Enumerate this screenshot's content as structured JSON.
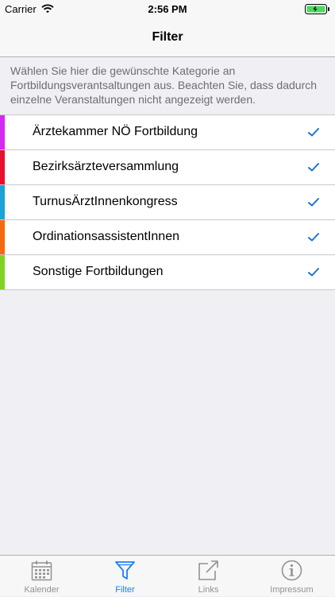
{
  "status_bar": {
    "carrier": "Carrier",
    "time": "2:56 PM"
  },
  "nav": {
    "title": "Filter"
  },
  "description": "Wählen Sie hier die gewünschte Kategorie an Fortbildungsverantsaltungen aus. Beachten Sie, dass dadurch einzelne Veranstaltungen nicht angezeigt werden.",
  "categories": [
    {
      "label": "Ärztekammer NÖ Fortbildung",
      "color": "#d42af2",
      "checked": true
    },
    {
      "label": "Bezirksärzteversammlung",
      "color": "#e8102c",
      "checked": true
    },
    {
      "label": "TurnusÄrztInnenkongress",
      "color": "#1aa3d8",
      "checked": true
    },
    {
      "label": "OrdinationsassistentInnen",
      "color": "#f56a0f",
      "checked": true
    },
    {
      "label": "Sonstige Fortbildungen",
      "color": "#7ed321",
      "checked": true
    }
  ],
  "tabs": [
    {
      "label": "Kalender",
      "icon": "calendar-icon",
      "active": false
    },
    {
      "label": "Filter",
      "icon": "filter-icon",
      "active": true
    },
    {
      "label": "Links",
      "icon": "external-link-icon",
      "active": false
    },
    {
      "label": "Impressum",
      "icon": "info-icon",
      "active": false
    }
  ],
  "colors": {
    "accent": "#1b7ff8",
    "check": "#1b6fd2",
    "inactive_tab": "#929292"
  }
}
